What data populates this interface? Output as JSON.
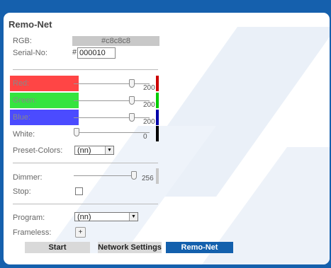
{
  "app": {
    "title": "Remo-Net"
  },
  "rgb": {
    "label": "RGB:",
    "value": "#c8c8c8"
  },
  "serial": {
    "label": "Serial-No:",
    "prefix": "#",
    "value": "000010"
  },
  "channels": [
    {
      "label": "Red:",
      "value": "200",
      "level": 200,
      "max": 255,
      "swatch_color": "#ff4545",
      "bar_color": "#cc0000"
    },
    {
      "label": "Green:",
      "value": "200",
      "level": 200,
      "max": 255,
      "swatch_color": "#35e43f",
      "bar_color": "#00cc00"
    },
    {
      "label": "Blue:",
      "value": "200",
      "level": 200,
      "max": 255,
      "swatch_color": "#4b4bff",
      "bar_color": "#0000a8"
    },
    {
      "label": "White:",
      "value": "0",
      "level": 0,
      "max": 255,
      "swatch_color": "",
      "bar_color": "#000000"
    }
  ],
  "preset": {
    "label": "Preset-Colors:",
    "selected": "(nn)"
  },
  "dimmer": {
    "label": "Dimmer:",
    "value": "256",
    "level": 256,
    "max": 256,
    "bar_color": "#c8c8c8"
  },
  "stop": {
    "label": "Stop:",
    "checked": false
  },
  "program": {
    "label": "Program:",
    "selected": "(nn)"
  },
  "frameless": {
    "label": "Frameless:",
    "button": "+"
  },
  "buttons": {
    "start": "Start",
    "network": "Network Settings",
    "remonet": "Remo-Net"
  },
  "colors": {
    "brand_blue": "#1560ad",
    "active_tab": "#1360ad",
    "inactive_button": "#d9d9d9",
    "rgb_field": "#c8c8c8"
  },
  "icons": {
    "dropdown": "chevron-down-icon",
    "add": "plus-icon"
  }
}
